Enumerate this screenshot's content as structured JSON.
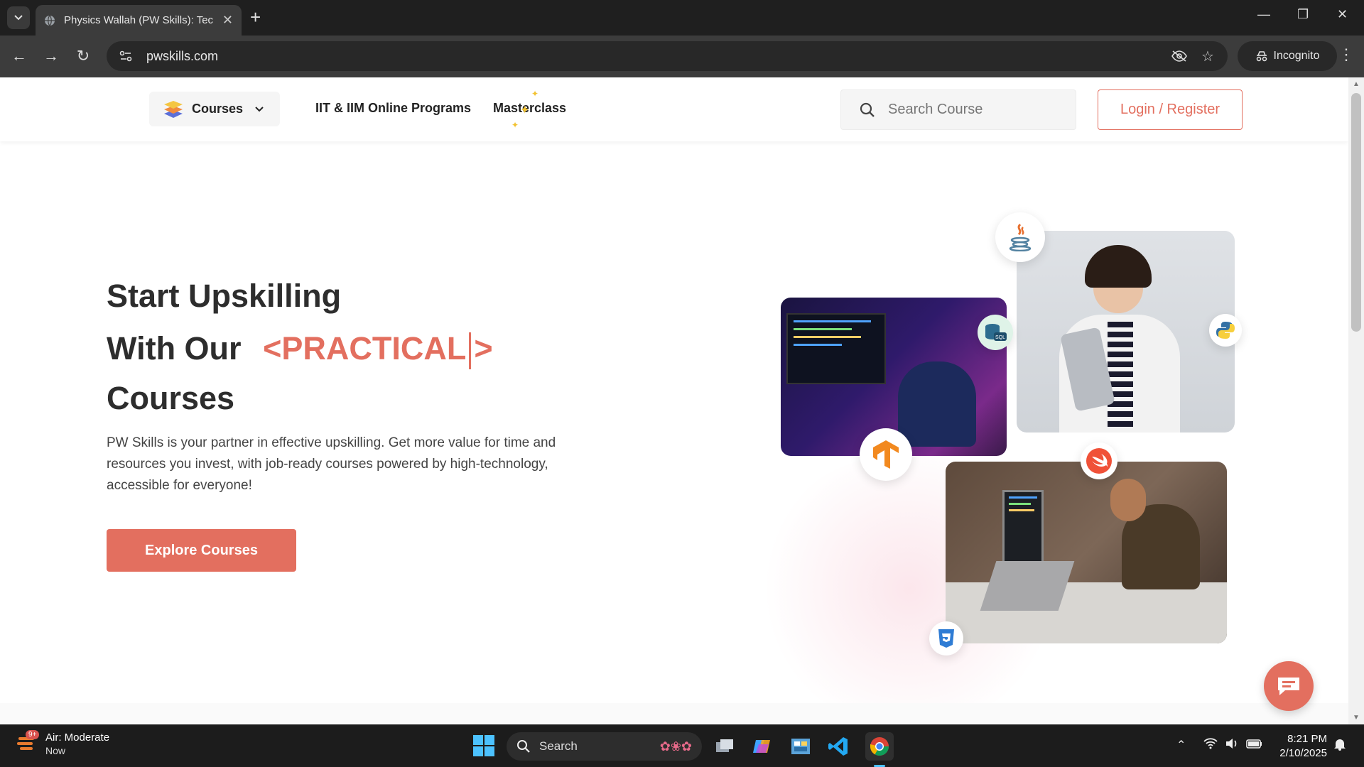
{
  "browser": {
    "tab_title": "Physics Wallah (PW Skills): Tech",
    "url": "pwskills.com",
    "incognito_label": "Incognito"
  },
  "header": {
    "courses_label": "Courses",
    "nav_links": [
      "IIT & IIM Online Programs",
      "Masterclass"
    ],
    "search_placeholder": "Search Course",
    "login_label": "Login / Register"
  },
  "hero": {
    "line1": "Start Upskilling",
    "line2_prefix": "With Our",
    "line2_open": "<PRACTICAL",
    "line2_close": ">",
    "line3": "Courses",
    "description": "PW Skills is your partner in effective upskilling. Get more value for time and resources you invest, with job-ready courses powered by high-technology, accessible for everyone!",
    "cta_label": "Explore Courses"
  },
  "tech_badges": [
    "java-icon",
    "sql-icon",
    "python-icon",
    "tensorflow-icon",
    "swift-icon",
    "css3-icon"
  ],
  "taskbar": {
    "weather_title": "Air: Moderate",
    "weather_sub": "Now",
    "weather_badge": "9+",
    "search_label": "Search",
    "time": "8:21 PM",
    "date": "2/10/2025"
  },
  "colors": {
    "accent": "#e36f5f",
    "text_dark": "#2d2d2d",
    "chrome_dark": "#1f1f1f"
  }
}
